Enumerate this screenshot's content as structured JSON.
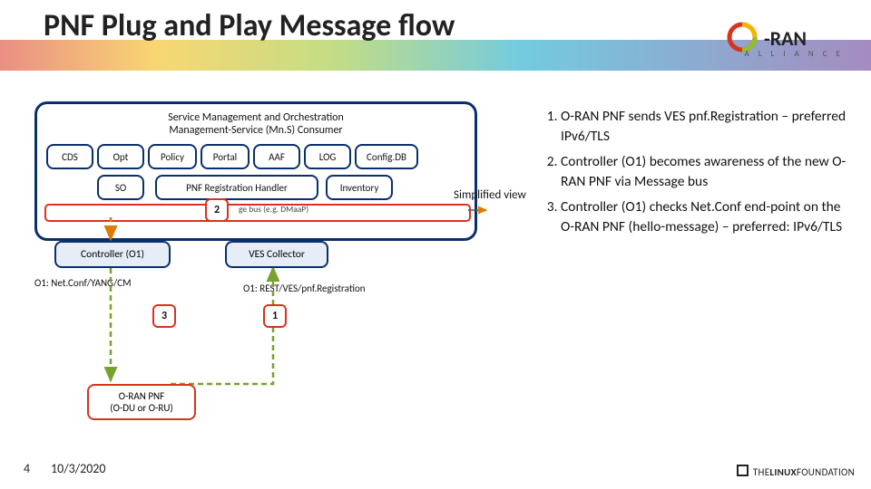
{
  "title": "PNF Plug and Play Message flow",
  "logo_alliance": "A L L I A N C E",
  "smo": {
    "heading_l1": "Service Management and Orchestration",
    "heading_l2": "Management-Service (Mn.S) Consumer",
    "cds": "CDS",
    "opt": "Opt",
    "policy": "Policy",
    "portal": "Portal",
    "aaf": "AAF",
    "log": "LOG",
    "configdb": "Config.DB",
    "so": "SO",
    "pnfreg": "PNF Registration Handler",
    "inventory": "Inventory",
    "bus": "ge bus (e.g. DMaaP)"
  },
  "controller": "Controller (O1)",
  "ves": "VES Collector",
  "label_left": "O1: Net.Conf/YANG/CM",
  "label_right": "O1: REST/VES/pnf.Registration",
  "oran_pnf_l1": "O-RAN PNF",
  "oran_pnf_l2": "(O-DU or O-RU)",
  "simplified": "Simplified view",
  "steps": {
    "s2": "2",
    "s3": "3",
    "s1": "1",
    "list": [
      "O-RAN PNF sends VES pnf.Registration – preferred IPv6/TLS",
      "Controller (O1) becomes awareness of the new O-RAN PNF via Message bus",
      "Controller (O1) checks Net.Conf end-point on the O-RAN PNF (hello-message) – preferred: IPv6/TLS"
    ]
  },
  "slide_number": "4",
  "date": "10/3/2020",
  "footer_linux": "THELINUXFOUNDATION"
}
